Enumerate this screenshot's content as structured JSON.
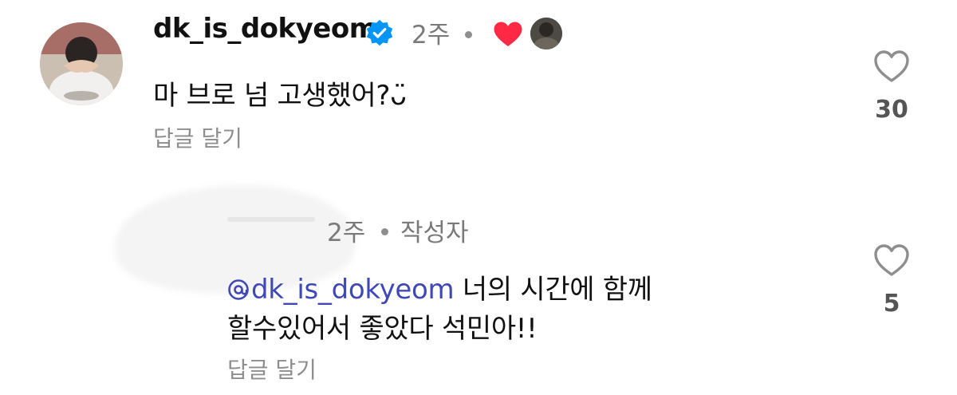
{
  "comment1": {
    "username": "dk_is_dokyeom",
    "verified": true,
    "time": "2주",
    "text": "마 브로 넘 고생했어?ᴗ̈",
    "reply_label": "답글 달기",
    "like_count": "30"
  },
  "comment2": {
    "time": "2주",
    "author_label": "작성자",
    "mention": "dk_is_dokyeom",
    "text_line1": "너의 시간에 함께",
    "text_line2": "할수있어서 좋았다 석민아!!",
    "reply_label": "답글 달기",
    "like_count": "5"
  },
  "colors": {
    "verified": "#0095f6",
    "creator_heart": "#ff2845",
    "mention": "#3f48b6",
    "secondary_text": "#8e8e8e"
  },
  "icons": {
    "verified": "verified-badge-icon",
    "creator_like": "heart-filled-icon",
    "like": "heart-outline-icon",
    "mention": "threads-at-icon"
  }
}
